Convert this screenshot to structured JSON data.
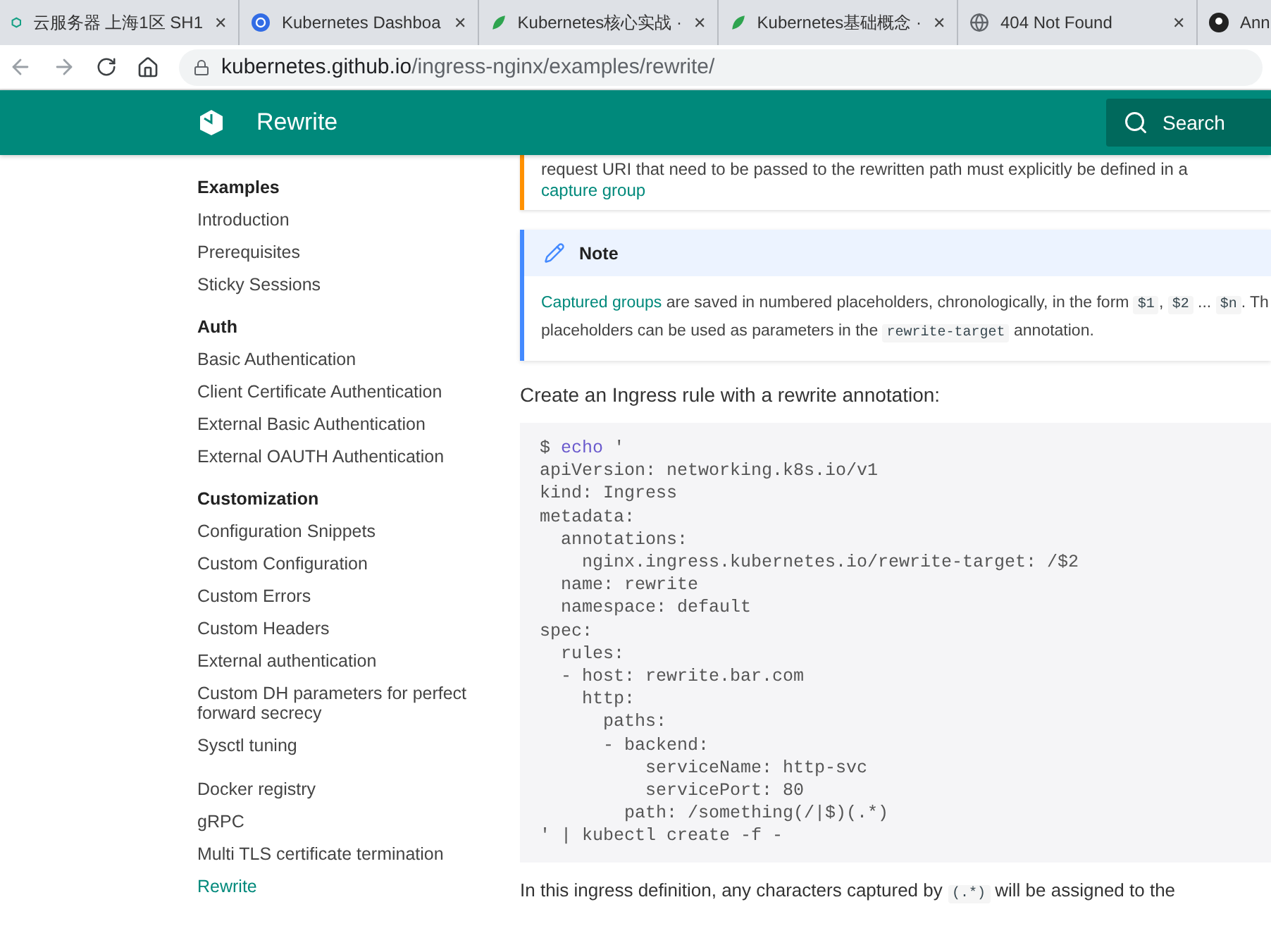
{
  "browser": {
    "tabs": [
      {
        "kind": "cloud",
        "title": "云服务器 上海1区 SH1",
        "selected": false
      },
      {
        "kind": "wheel",
        "title": "Kubernetes Dashboa",
        "selected": false
      },
      {
        "kind": "leaf",
        "title": "Kubernetes核心实战 ·",
        "selected": false
      },
      {
        "kind": "leaf",
        "title": "Kubernetes基础概念 ·",
        "selected": false
      },
      {
        "kind": "globe",
        "title": "404 Not Found",
        "selected": false
      },
      {
        "kind": "avatar",
        "title": "Ann",
        "selected": false
      }
    ],
    "close": "✕",
    "url": {
      "host": "kubernetes.github.io",
      "path": "/ingress-nginx/examples/rewrite/"
    }
  },
  "header": {
    "title": "Rewrite",
    "search": {
      "placeholder": "Search"
    }
  },
  "sidebar": {
    "groups": [
      {
        "heading": "Examples",
        "items": [
          {
            "label": "Introduction",
            "selected": false
          },
          {
            "label": "Prerequisites",
            "selected": false
          },
          {
            "label": "Sticky Sessions",
            "selected": false
          }
        ]
      },
      {
        "heading": "Auth",
        "items": [
          {
            "label": "Basic Authentication",
            "selected": false
          },
          {
            "label": "Client Certificate Authentication",
            "selected": false
          },
          {
            "label": "External Basic Authentication",
            "selected": false
          },
          {
            "label": "External OAUTH Authentication",
            "selected": false
          }
        ]
      },
      {
        "heading": "Customization",
        "items": [
          {
            "label": "Configuration Snippets",
            "selected": false
          },
          {
            "label": "Custom Configuration",
            "selected": false
          },
          {
            "label": "Custom Errors",
            "selected": false
          },
          {
            "label": "Custom Headers",
            "selected": false
          },
          {
            "label": "External authentication",
            "selected": false
          },
          {
            "label": "Custom DH parameters for perfect forward secrecy",
            "selected": false
          },
          {
            "label": "Sysctl tuning",
            "selected": false
          }
        ]
      },
      {
        "items": [
          {
            "label": "Docker registry",
            "selected": false
          },
          {
            "label": "gRPC",
            "selected": false
          },
          {
            "label": "Multi TLS certificate termination",
            "selected": false
          },
          {
            "label": "Rewrite",
            "selected": true
          }
        ]
      }
    ]
  },
  "content": {
    "warning": {
      "segments": [
        {
          "kind": "text",
          "text": "request URI that need to be passed to the rewritten path must explicitly be defined in a "
        },
        {
          "kind": "link",
          "text": "capture group"
        }
      ]
    },
    "note": {
      "title": "Note",
      "lines": [
        [
          {
            "kind": "link",
            "text": "Captured groups"
          },
          {
            "kind": "text",
            "text": " are saved in numbered placeholders, chronologically, in the form "
          },
          {
            "kind": "code",
            "text": "$1"
          },
          {
            "kind": "text",
            "text": ", "
          },
          {
            "kind": "code",
            "text": "$2"
          },
          {
            "kind": "text",
            "text": " ... "
          },
          {
            "kind": "code",
            "text": "$n"
          },
          {
            "kind": "text",
            "text": ". Th"
          }
        ],
        [
          {
            "kind": "text",
            "text": "placeholders can be used as parameters in the "
          },
          {
            "kind": "code",
            "text": "rewrite-target"
          },
          {
            "kind": "text",
            "text": " annotation."
          }
        ]
      ]
    },
    "intro": "Create an Ingress rule with a rewrite annotation:",
    "code": {
      "command": {
        "prompt": "$",
        "word": "echo",
        "arg": "'"
      },
      "lines": [
        "apiVersion: networking.k8s.io/v1",
        "kind: Ingress",
        "metadata:",
        "  annotations:",
        "    nginx.ingress.kubernetes.io/rewrite-target: /$2",
        "  name: rewrite",
        "  namespace: default",
        "spec:",
        "  rules:",
        "  - host: rewrite.bar.com",
        "    http:",
        "      paths:",
        "      - backend:",
        "          serviceName: http-svc",
        "          servicePort: 80",
        "        path: /something(/|$)(.*)",
        "' | kubectl create -f -"
      ]
    },
    "outro": [
      {
        "kind": "text",
        "text": "In this ingress definition, any characters captured by "
      },
      {
        "kind": "code",
        "text": "(.*)"
      },
      {
        "kind": "text",
        "text": " will be assigned to the"
      }
    ]
  }
}
